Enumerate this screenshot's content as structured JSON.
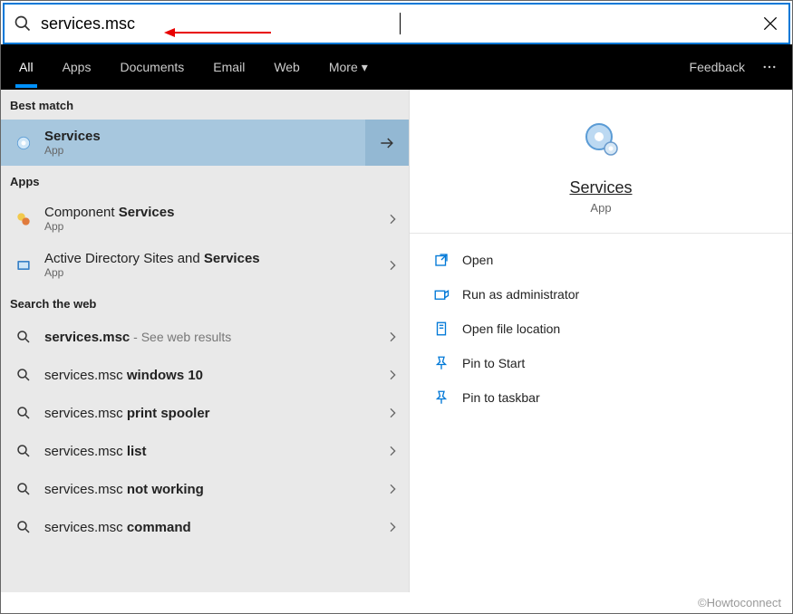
{
  "search": {
    "query": "services.msc"
  },
  "tabs": {
    "all": "All",
    "apps": "Apps",
    "documents": "Documents",
    "email": "Email",
    "web": "Web",
    "more": "More"
  },
  "topbar": {
    "feedback": "Feedback"
  },
  "sections": {
    "best_match": "Best match",
    "apps": "Apps",
    "search_web": "Search the web"
  },
  "best": {
    "title": "Services",
    "sub": "App"
  },
  "app_results": [
    {
      "pre": "Component ",
      "bold": "Services",
      "sub": "App"
    },
    {
      "pre": "Active Directory Sites and ",
      "bold": "Services",
      "sub": "App"
    }
  ],
  "web_results": [
    {
      "bold": "services.msc",
      "suffix": " - See web results"
    },
    {
      "pre": "services.msc ",
      "bold": "windows 10"
    },
    {
      "pre": "services.msc ",
      "bold": "print spooler"
    },
    {
      "pre": "services.msc ",
      "bold": "list"
    },
    {
      "pre": "services.msc ",
      "bold": "not working"
    },
    {
      "pre": "services.msc ",
      "bold": "command"
    }
  ],
  "preview": {
    "title": "Services",
    "sub": "App"
  },
  "actions": {
    "open": "Open",
    "run_admin": "Run as administrator",
    "open_location": "Open file location",
    "pin_start": "Pin to Start",
    "pin_taskbar": "Pin to taskbar"
  },
  "footer": "©Howtoconnect"
}
